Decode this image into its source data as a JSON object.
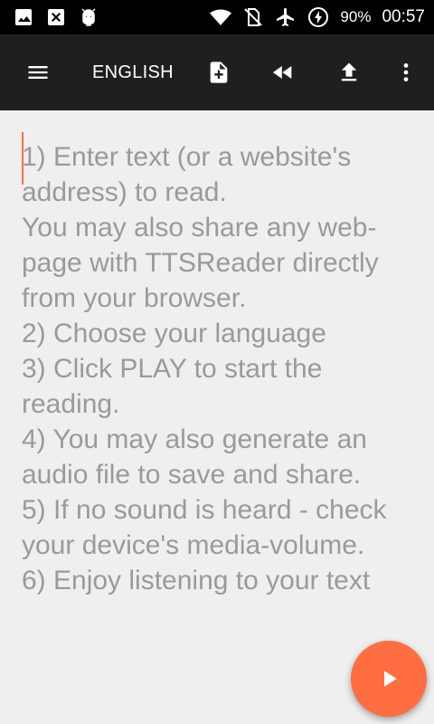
{
  "status_bar": {
    "battery": "90%",
    "time": "00:57",
    "left_icons": [
      "image-icon",
      "close-box-icon",
      "android-debug-icon"
    ],
    "right_icons": [
      "wifi-icon",
      "no-sim-icon",
      "airplane-icon",
      "battery-saver-icon"
    ]
  },
  "toolbar": {
    "language": "ENGLISH",
    "icons": [
      "menu-icon",
      "add-file-icon",
      "rewind-icon",
      "upload-icon",
      "more-vert-icon"
    ]
  },
  "editor": {
    "text": "1) Enter text (or a website's address) to read.\nYou may also share any web-page with TTSReader directly from your browser.\n2) Choose your language\n3) Click PLAY to start the reading.\n4) You may also generate an audio file to save and share.\n5) If no sound is heard - check your device's media-volume.\n6) Enjoy listening to your text"
  },
  "fab": {
    "icon": "play-icon"
  },
  "colors": {
    "accent": "#ff6e40",
    "toolbar": "#1f1f1f",
    "statusbar": "#000000",
    "text": "#9a9a9a",
    "background": "#efefef"
  }
}
